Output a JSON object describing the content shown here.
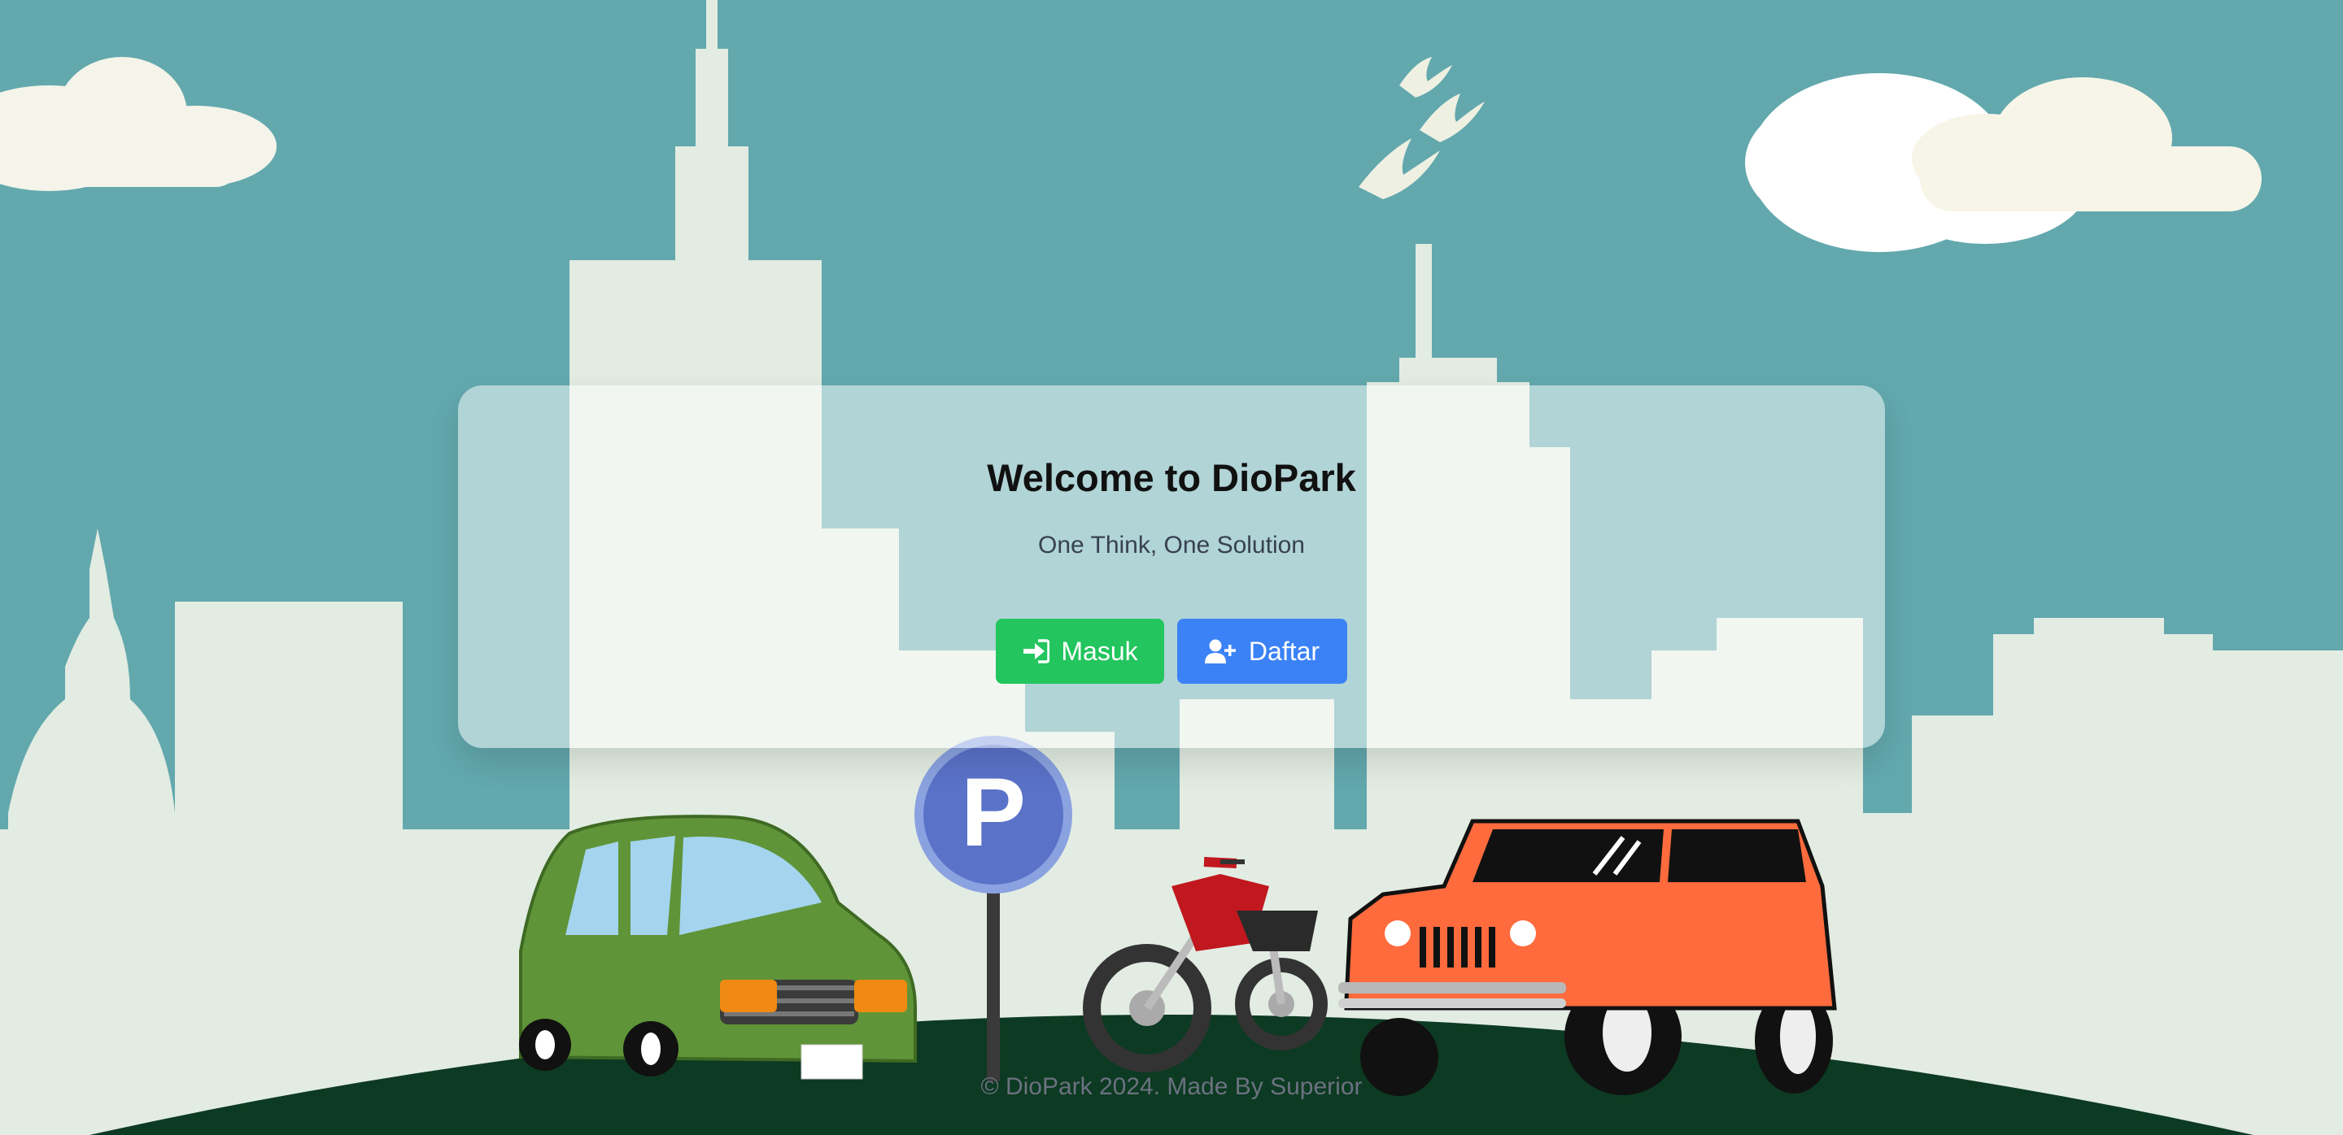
{
  "hero": {
    "title": "Welcome to DioPark",
    "tagline": "One Think, One Solution"
  },
  "actions": {
    "login_label": "Masuk",
    "register_label": "Daftar"
  },
  "icons": {
    "login": "sign-in-icon",
    "register": "user-plus-icon",
    "parking_sign_letter": "P"
  },
  "colors": {
    "sky": "#62a8ad",
    "skyline": "#e2ece2",
    "ground": "#0d3a22",
    "login_button": "#22c55e",
    "register_button": "#3b82f6"
  },
  "footer": {
    "text": "© DioPark 2024. Made By Superior"
  }
}
